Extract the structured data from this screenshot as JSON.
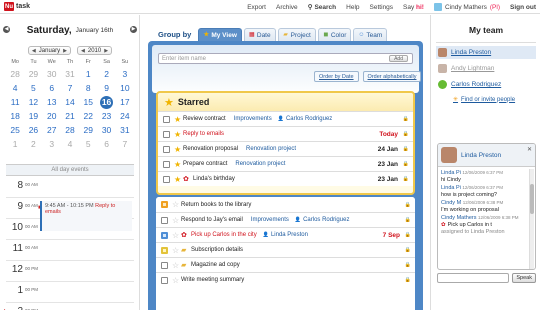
{
  "app": {
    "logo_mark": "Nu",
    "logo_text": "task"
  },
  "topnav": {
    "export": "Export",
    "archive": "Archive",
    "search": "Search",
    "help": "Help",
    "settings": "Settings",
    "say": "Say",
    "hi": "hi!",
    "user_name": "Cindy Mathers",
    "user_suffix": "(Pl)",
    "sign_out": "Sign out"
  },
  "calendar": {
    "day_name": "Saturday,",
    "day_date": "January 16th",
    "month_select": "January",
    "year_select": "2010",
    "weekday_headers": [
      "Mo",
      "Tu",
      "We",
      "Th",
      "Fr",
      "Sa",
      "Su"
    ],
    "weeks": [
      [
        "28",
        "29",
        "30",
        "31",
        "1",
        "2",
        "3"
      ],
      [
        "4",
        "5",
        "6",
        "7",
        "8",
        "9",
        "10"
      ],
      [
        "11",
        "12",
        "13",
        "14",
        "15",
        "16",
        "17"
      ],
      [
        "18",
        "19",
        "20",
        "21",
        "22",
        "23",
        "24"
      ],
      [
        "25",
        "26",
        "27",
        "28",
        "29",
        "30",
        "31"
      ],
      [
        "1",
        "2",
        "3",
        "4",
        "5",
        "6",
        "7"
      ]
    ],
    "selected_day": "16",
    "all_day_label": "All day events",
    "hours": [
      {
        "h": "8",
        "ampm": "00 AM"
      },
      {
        "h": "9",
        "ampm": "00 AM"
      },
      {
        "h": "10",
        "ampm": "00 AM"
      },
      {
        "h": "11",
        "ampm": "00 AM"
      },
      {
        "h": "12",
        "ampm": "00 PM"
      },
      {
        "h": "1",
        "ampm": "00 PM"
      },
      {
        "h": "2",
        "ampm": "00 PM"
      }
    ],
    "event_time": "9:45 AM - 10:15 PM",
    "event_title": "Reply to emails"
  },
  "groupby": {
    "label": "Group by",
    "tabs": [
      {
        "label": "My View",
        "icon": "star-icon",
        "active": true
      },
      {
        "label": "Date",
        "icon": "calendar-icon",
        "active": false
      },
      {
        "label": "Project",
        "icon": "folder-icon",
        "active": false
      },
      {
        "label": "Color",
        "icon": "palette-icon",
        "active": false
      },
      {
        "label": "Team",
        "icon": "people-icon",
        "active": false
      }
    ]
  },
  "newitem": {
    "placeholder": "Enter item name",
    "add_label": "Add"
  },
  "sort": {
    "by_date": "Order by Date",
    "alpha": "Order alphabetically"
  },
  "starred": {
    "title": "Starred",
    "items": [
      {
        "title": "Review contract",
        "tag": "Improvements",
        "assignee": "Carlos Rodriguez",
        "due": "",
        "red": false,
        "icon": ""
      },
      {
        "title": "Reply to emails",
        "tag": "",
        "assignee": "",
        "due": "Today",
        "red": true,
        "icon": ""
      },
      {
        "title": "Renovation proposal",
        "tag": "Renovation project",
        "assignee": "",
        "due": "24 Jan",
        "red": false,
        "icon": ""
      },
      {
        "title": "Prepare contract",
        "tag": "Renovation project",
        "assignee": "",
        "due": "23 Jan",
        "red": false,
        "icon": ""
      },
      {
        "title": "Linda's birthday",
        "tag": "",
        "assignee": "",
        "due": "23 Jan",
        "red": false,
        "icon": "gift-icon"
      }
    ]
  },
  "others": {
    "items": [
      {
        "title": "Return books to the library",
        "tag": "",
        "assignee": "",
        "due": "",
        "red": false,
        "cb": "orange",
        "icon": ""
      },
      {
        "title": "Respond to Jay's email",
        "tag": "Improvements",
        "assignee": "Carlos Rodriguez",
        "due": "",
        "red": false,
        "cb": "",
        "icon": ""
      },
      {
        "title": "Pick up Carlos in the city",
        "tag": "",
        "assignee": "Linda Preston",
        "due": "7 Sep",
        "red": true,
        "cb": "blue",
        "icon": "gift-icon"
      },
      {
        "title": "Subscription details",
        "tag": "",
        "assignee": "",
        "due": "",
        "red": false,
        "cb": "yellow",
        "icon": "folder-icon"
      },
      {
        "title": "Magazine ad copy",
        "tag": "",
        "assignee": "",
        "due": "",
        "red": false,
        "cb": "",
        "icon": "folder-icon"
      },
      {
        "title": "Write meeting summary",
        "tag": "",
        "assignee": "",
        "due": "",
        "red": false,
        "cb": "",
        "icon": ""
      }
    ]
  },
  "team": {
    "title": "My team",
    "members": [
      {
        "name": "Linda Preston",
        "state": "selected"
      },
      {
        "name": "Andy Lightman",
        "state": "inactive"
      },
      {
        "name": "Carlos Rodriguez",
        "state": "normal"
      }
    ],
    "find_link": "Find or invite people"
  },
  "chat": {
    "name": "Linda Preston",
    "messages": [
      {
        "type": "msg",
        "name": "Linda Pi",
        "time": "12/06/2009 6:37 PM",
        "text": "hi Cindy"
      },
      {
        "type": "msg",
        "name": "Linda Pi",
        "time": "12/06/2009 6:37 PM",
        "text": "how is project coming?"
      },
      {
        "type": "msg",
        "name": "Cindy M",
        "time": "12/06/2009 6:38 PM",
        "text": "I'm working on proposal"
      },
      {
        "type": "item",
        "name": "Cindy Mathers",
        "time": "12/06/2009 6:38 PM",
        "text": "Pick up Carlos in t",
        "sub": "assigned to Linda Preston"
      }
    ],
    "speak_label": "Speak"
  }
}
